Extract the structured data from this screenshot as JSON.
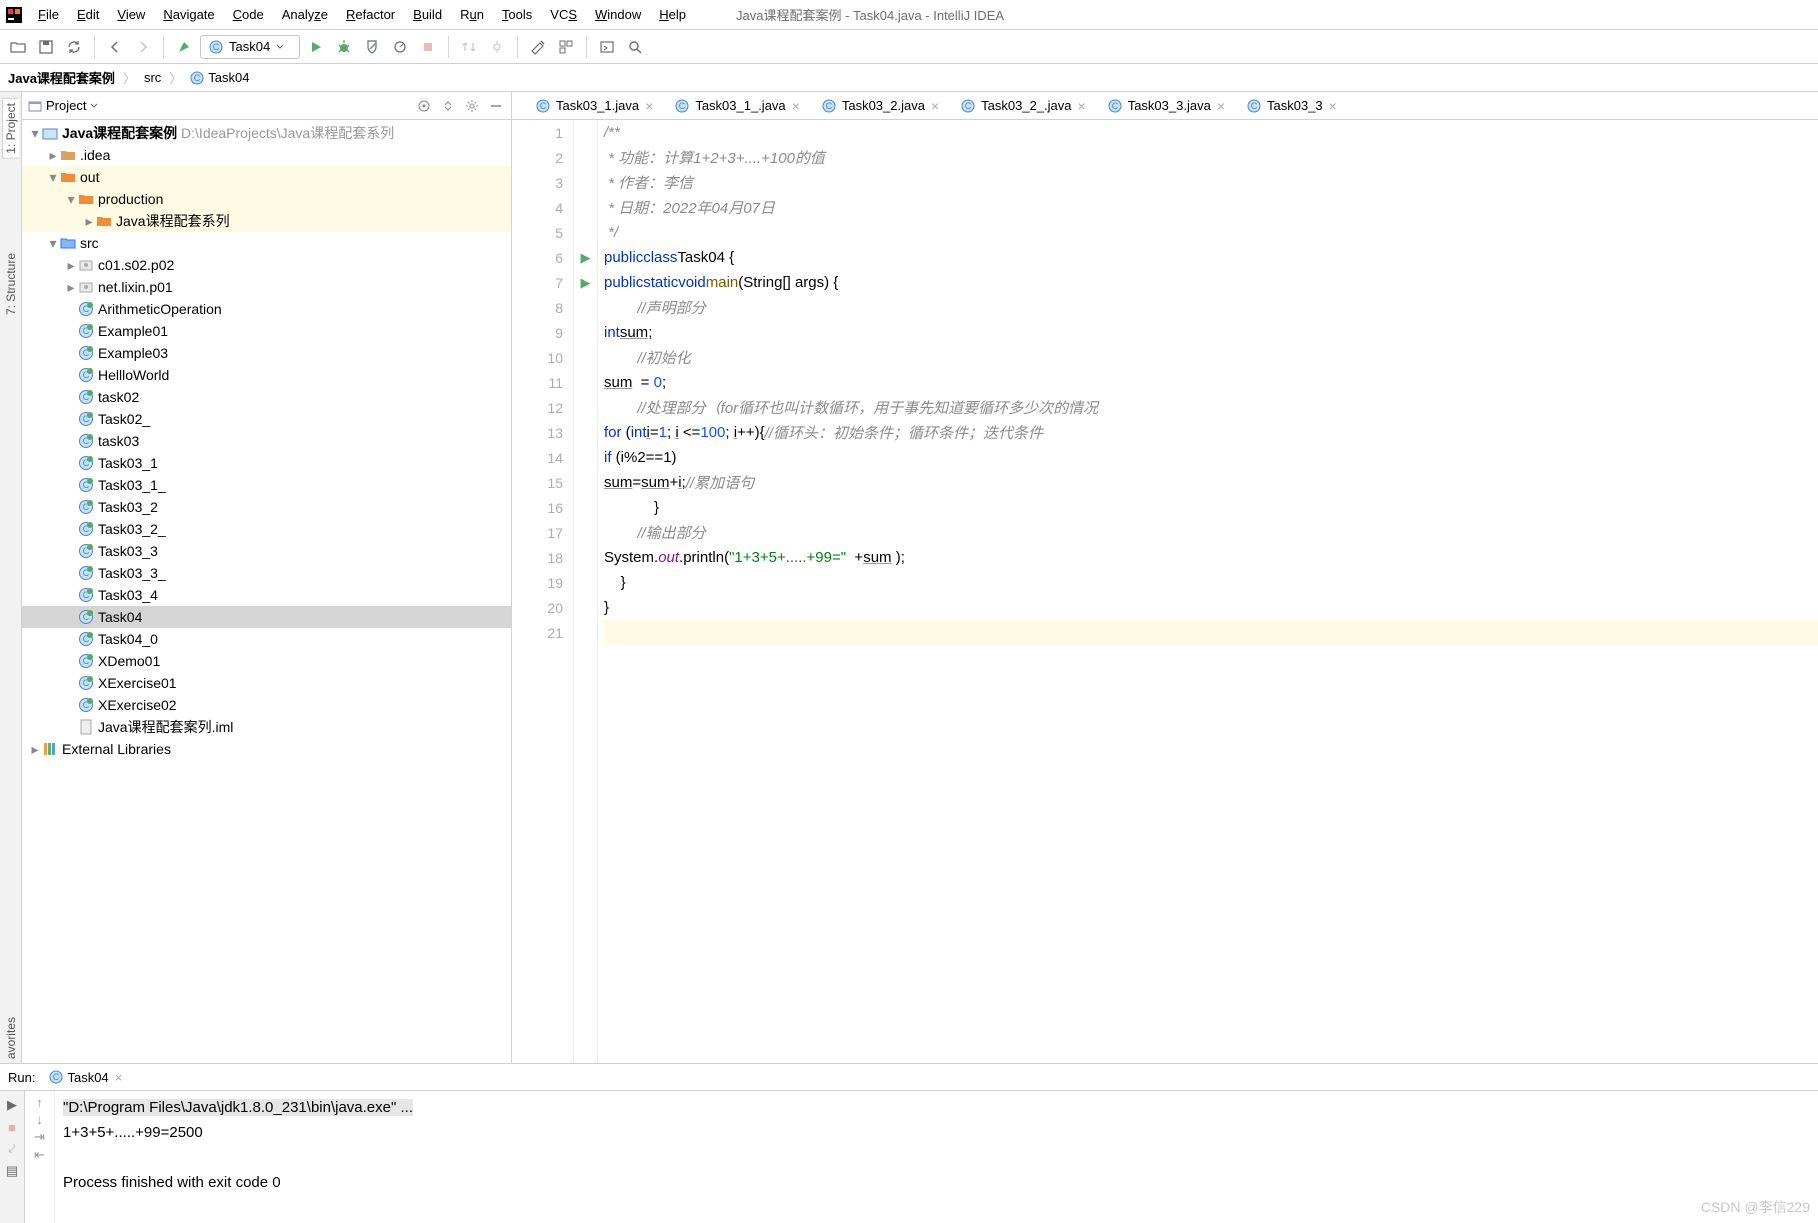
{
  "window_title": "Java课程配套案例 - Task04.java - IntelliJ IDEA",
  "menu": [
    "File",
    "Edit",
    "View",
    "Navigate",
    "Code",
    "Analyze",
    "Refactor",
    "Build",
    "Run",
    "Tools",
    "VCS",
    "Window",
    "Help"
  ],
  "run_config": "Task04",
  "breadcrumb": {
    "root": "Java课程配套案例",
    "src": "src",
    "file": "Task04"
  },
  "project_panel_title": "Project",
  "tree": {
    "root": {
      "name": "Java课程配套案例",
      "path": "D:\\IdeaProjects\\Java课程配套系列"
    },
    "idea": ".idea",
    "out": "out",
    "production": "production",
    "prod_child": "Java课程配套系列",
    "src": "src",
    "pkg1": "c01.s02.p02",
    "pkg2": "net.lixin.p01",
    "files": [
      "ArithmeticOperation",
      "Example01",
      "Example03",
      "HellloWorld",
      "task02",
      "Task02_",
      "task03",
      "Task03_1",
      "Task03_1_",
      "Task03_2",
      "Task03_2_",
      "Task03_3",
      "Task03_3_",
      "Task03_4",
      "Task04",
      "Task04_0",
      "XDemo01",
      "XExercise01",
      "XExercise02"
    ],
    "iml": "Java课程配套案列.iml",
    "ext": "External Libraries"
  },
  "editor_tabs": [
    "Task03_1.java",
    "Task03_1_.java",
    "Task03_2.java",
    "Task03_2_.java",
    "Task03_3.java",
    "Task03_3"
  ],
  "code": {
    "l1": "/**",
    "l2": " * 功能：计算1+2+3+....+100的值",
    "l3": " * 作者：李信",
    "l4": " * 日期：2022年04月07日",
    "l5": " */",
    "l6_public": "public",
    "l6_class": "class",
    "l6_name": "Task04",
    "l6_brace": " {",
    "l7_public": "public",
    "l7_static": "static",
    "l7_void": "void",
    "l7_main": "main",
    "l7_args": "(String[] args) {",
    "l8": "        //声明部分",
    "l9_int": "int",
    "l9_sum": "sum",
    "l9_semi": ";",
    "l10": "        //初始化",
    "l11_sum": "sum",
    "l11_eq": "  = ",
    "l11_zero": "0",
    "l11_semi": ";",
    "l12": "        //处理部分（for循环也叫计数循环，用于事先知道要循环多少次的情况",
    "l13_for": "for",
    "l13_paren": " (",
    "l13_int": "int",
    "l13_i1": "i",
    "l13_eq1": "=",
    "l13_one": "1",
    "l13_sc1": "; ",
    "l13_i2": "i",
    "l13_le": " <=",
    "l13_100": "100",
    "l13_sc2": "; ",
    "l13_i3": "i",
    "l13_pp": "++){",
    "l13_cm": "//循环头：初始条件；循环条件；迭代条件",
    "l14_if": "if",
    "l14_cond": " (i%2==1)",
    "l15_lhs": "sum",
    "l15_eq": "=",
    "l15_rhs": "sum",
    "l15_plus": "+",
    "l15_i": "i",
    "l15_semi": ";",
    "l15_cm": "//累加语句",
    "l16": "            }",
    "l17": "        //输出部分",
    "l18_sys": "System.",
    "l18_out": "out",
    "l18_pl": ".println(",
    "l18_str": "\"1+3+5+.....+99=\"",
    "l18_mid": "  +",
    "l18_sum": "sum",
    "l18_end": " );",
    "l19": "    }",
    "l20": "}",
    "l21": ""
  },
  "run_tab": "Task04",
  "run_label": "Run:",
  "console": {
    "l1": "\"D:\\Program Files\\Java\\jdk1.8.0_231\\bin\\java.exe\" ...",
    "l2": "1+3+5+.....+99=2500",
    "l3": "Process finished with exit code 0"
  },
  "watermark": "CSDN @李信229",
  "side_tabs": {
    "project": "1: Project",
    "structure": "7: Structure",
    "fav": "avorites"
  }
}
